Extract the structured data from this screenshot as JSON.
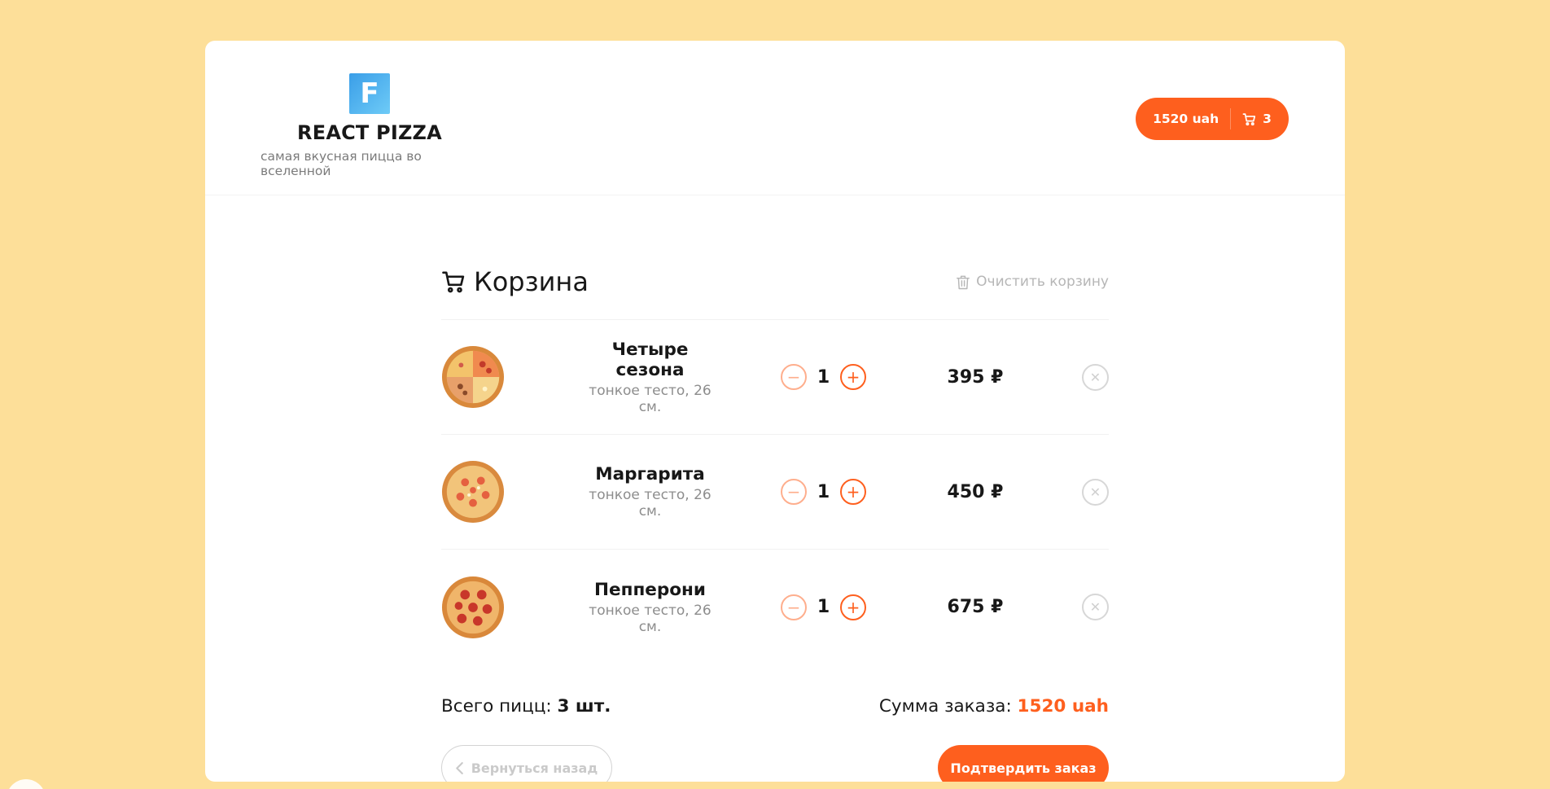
{
  "header": {
    "logo_letter": "F",
    "title": "REACT PIZZA",
    "subtitle": "самая вкусная пицца во вселенной",
    "cart_total": "1520 uah",
    "cart_count": "3"
  },
  "cart": {
    "title": "Корзина",
    "clear_label": "Очистить корзину",
    "items": [
      {
        "name": "Четыре сезона",
        "desc": "тонкое тесто, 26 см.",
        "count": "1",
        "price": "395 ₽"
      },
      {
        "name": "Маргарита",
        "desc": "тонкое тесто, 26 см.",
        "count": "1",
        "price": "450 ₽"
      },
      {
        "name": "Пепперони",
        "desc": "тонкое тесто, 26 см.",
        "count": "1",
        "price": "675 ₽"
      }
    ],
    "total_count_label": "Всего пицц:",
    "total_count_value": "3 шт.",
    "total_sum_label": "Сумма заказа:",
    "total_sum_value": "1520 uah",
    "back_label": "Вернуться назад",
    "pay_label": "Подтвердить заказ"
  },
  "colors": {
    "accent": "#fe5f1e",
    "background": "#fddf99"
  }
}
